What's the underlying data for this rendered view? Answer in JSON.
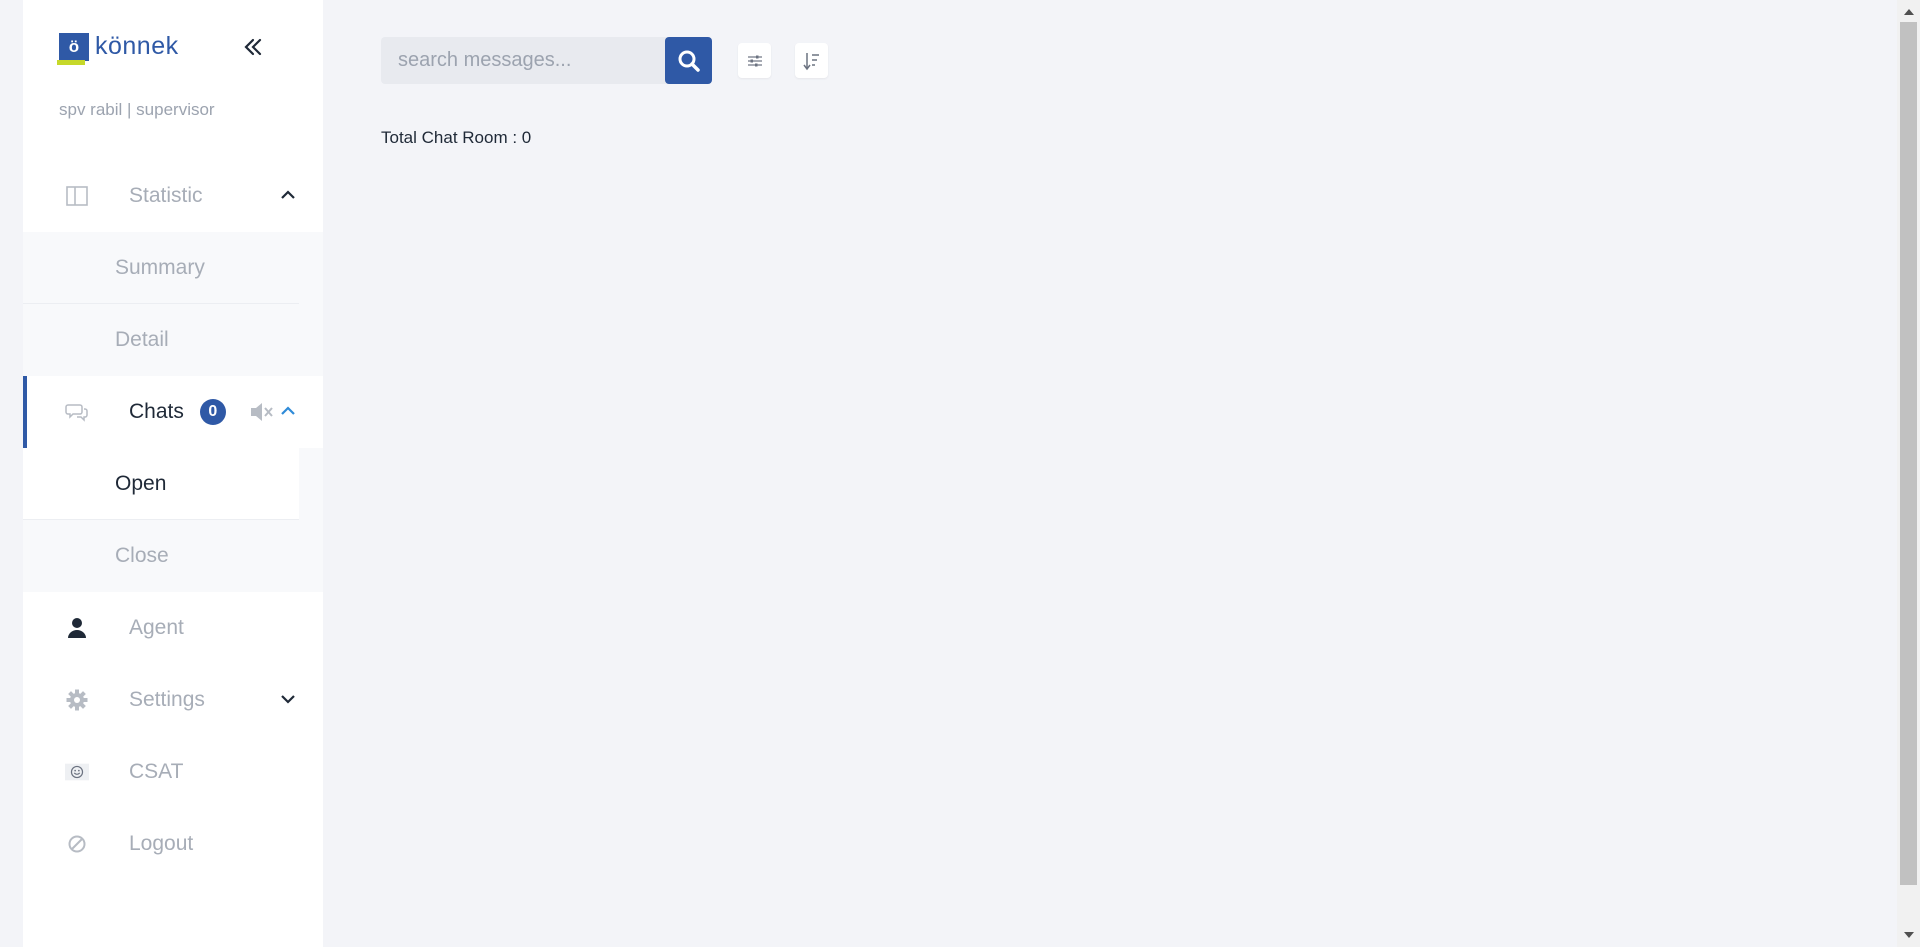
{
  "brand": {
    "logo_letter": "ö",
    "name": "könnek"
  },
  "user": {
    "line": "spv rabil | supervisor"
  },
  "sidebar": {
    "statistic": {
      "label": "Statistic",
      "icon": "columns-icon",
      "children": [
        "Summary",
        "Detail"
      ]
    },
    "chats": {
      "label": "Chats",
      "badge": "0",
      "icon": "chat-bubbles-icon",
      "children": [
        "Open",
        "Close"
      ]
    },
    "agent": {
      "label": "Agent",
      "icon": "person-icon"
    },
    "settings": {
      "label": "Settings",
      "icon": "gear-icon"
    },
    "csat": {
      "label": "CSAT",
      "icon": "smiley-icon"
    },
    "logout": {
      "label": "Logout",
      "icon": "ban-icon"
    }
  },
  "search": {
    "placeholder": "search messages...",
    "value": ""
  },
  "main": {
    "total_label": "Total Chat Room : 0"
  },
  "colors": {
    "accent": "#2f59a6",
    "logo_green": "#c6d82a",
    "muted_text": "#a7adb7",
    "background": "#f3f4f8"
  }
}
